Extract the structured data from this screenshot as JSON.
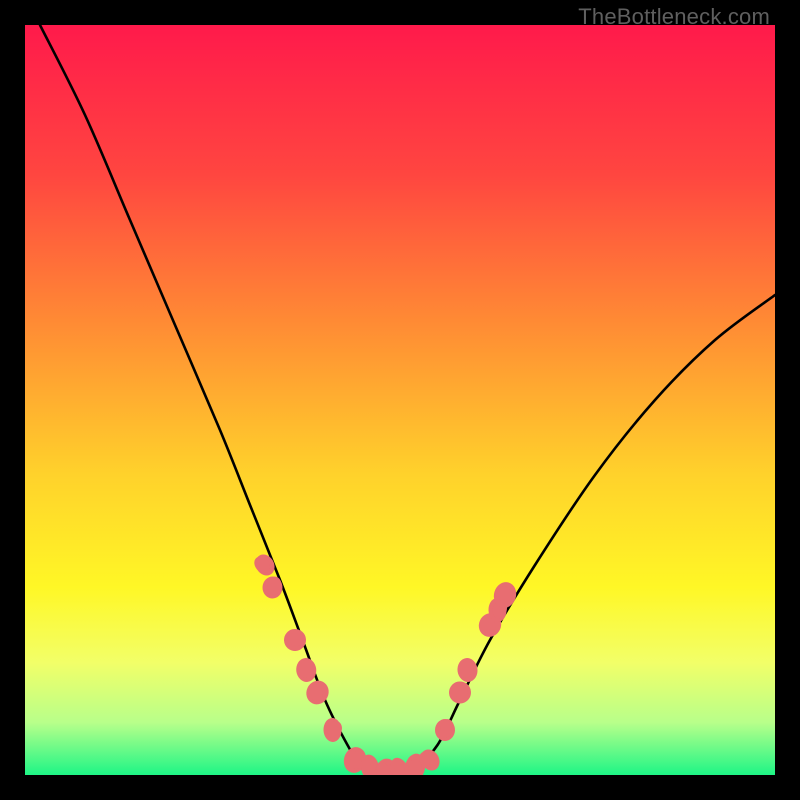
{
  "watermark": "TheBottleneck.com",
  "chart_data": {
    "type": "line",
    "title": "",
    "xlabel": "",
    "ylabel": "",
    "xlim": [
      0,
      100
    ],
    "ylim": [
      0,
      100
    ],
    "grid": false,
    "gradient_stops": [
      {
        "offset": 0,
        "color": "#ff1a4b"
      },
      {
        "offset": 20,
        "color": "#ff4640"
      },
      {
        "offset": 40,
        "color": "#ff8c34"
      },
      {
        "offset": 60,
        "color": "#ffd22b"
      },
      {
        "offset": 75,
        "color": "#fff726"
      },
      {
        "offset": 85,
        "color": "#f2ff68"
      },
      {
        "offset": 93,
        "color": "#b8ff8a"
      },
      {
        "offset": 100,
        "color": "#1ef586"
      }
    ],
    "series": [
      {
        "name": "bottleneck-curve",
        "x": [
          2,
          8,
          14,
          20,
          26,
          30,
          34,
          37,
          40,
          43,
          45,
          47,
          49,
          52,
          55,
          58,
          62,
          68,
          76,
          84,
          92,
          100
        ],
        "y": [
          100,
          88,
          74,
          60,
          46,
          36,
          26,
          18,
          10,
          4,
          1,
          0,
          0,
          1,
          4,
          10,
          18,
          28,
          40,
          50,
          58,
          64
        ]
      }
    ],
    "decorative_points": {
      "name": "scatter-markers",
      "points": [
        {
          "x": 32,
          "y": 28
        },
        {
          "x": 33,
          "y": 25
        },
        {
          "x": 36,
          "y": 18
        },
        {
          "x": 37.5,
          "y": 14
        },
        {
          "x": 39,
          "y": 11
        },
        {
          "x": 41,
          "y": 6
        },
        {
          "x": 44,
          "y": 2
        },
        {
          "x": 46,
          "y": 1
        },
        {
          "x": 48,
          "y": 0.5
        },
        {
          "x": 50,
          "y": 0.5
        },
        {
          "x": 52,
          "y": 1
        },
        {
          "x": 54,
          "y": 2
        },
        {
          "x": 56,
          "y": 6
        },
        {
          "x": 58,
          "y": 11
        },
        {
          "x": 59,
          "y": 14
        },
        {
          "x": 62,
          "y": 20
        },
        {
          "x": 63,
          "y": 22
        },
        {
          "x": 64,
          "y": 24
        }
      ]
    }
  }
}
